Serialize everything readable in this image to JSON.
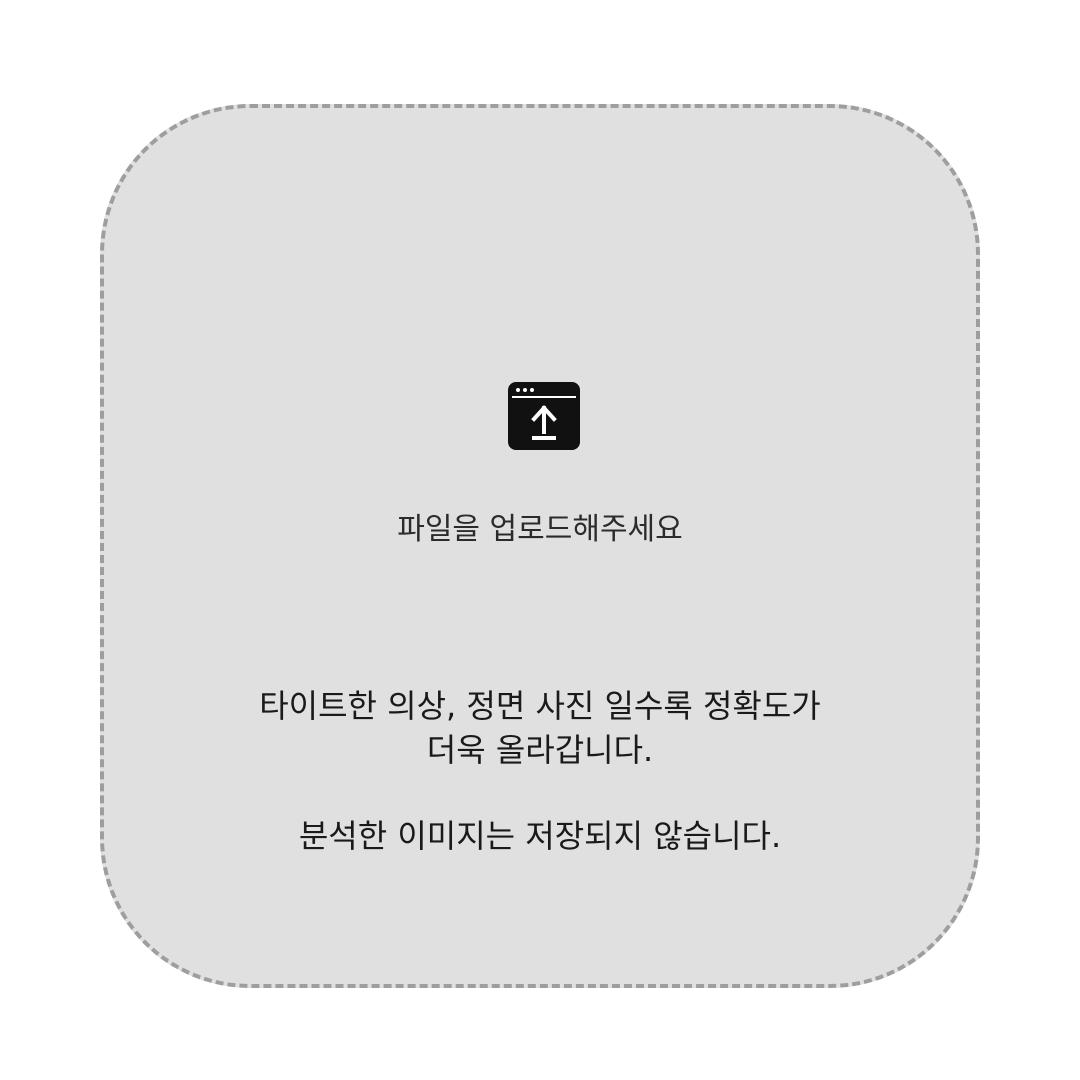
{
  "dropzone": {
    "prompt": "파일을 업로드해주세요",
    "icon": "upload-window-icon",
    "tips": [
      "타이트한 의상, 정면 사진 일수록 정확도가",
      "더욱 올라갑니다.",
      "분석한 이미지는 저장되지 않습니다."
    ]
  },
  "colors": {
    "dropzone_background": "#e0e0e0",
    "dropzone_border": "#9e9e9e",
    "icon": "#111111"
  }
}
